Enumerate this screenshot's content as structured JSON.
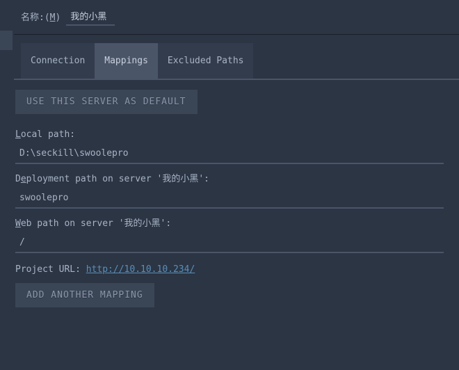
{
  "header": {
    "name_label_prefix": "名称:(",
    "name_label_mnemonic": "M",
    "name_label_suffix": ")",
    "name_value": "我的小黑"
  },
  "tabs": {
    "connection": "Connection",
    "mappings": "Mappings",
    "excluded": "Excluded Paths",
    "active_index": 1
  },
  "buttons": {
    "use_default": "USE THIS SERVER AS DEFAULT",
    "add_mapping": "ADD ANOTHER MAPPING"
  },
  "fields": {
    "local_path": {
      "label_mnemonic": "L",
      "label_rest": "ocal path:",
      "value": "D:\\seckill\\swoolepro"
    },
    "deployment_path": {
      "label_prefix": "D",
      "label_mnemonic": "e",
      "label_rest": "ployment path on server '我的小黑':",
      "value": "swoolepro"
    },
    "web_path": {
      "label_mnemonic": "W",
      "label_rest": "eb path on server '我的小黑':",
      "value": "/"
    }
  },
  "project_url": {
    "label": "Project URL: ",
    "url": "http://10.10.10.234/"
  }
}
